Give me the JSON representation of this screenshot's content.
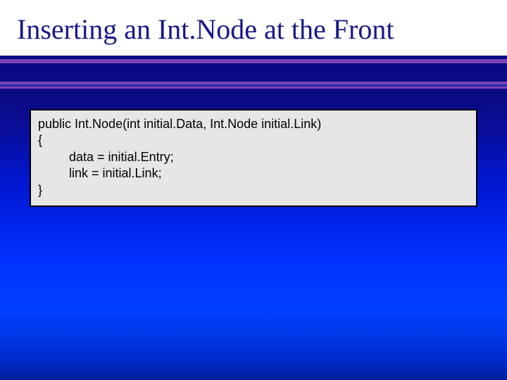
{
  "title": "Inserting an Int.Node at the Front",
  "code": {
    "line1": "public Int.Node(int initial.Data, Int.Node initial.Link)",
    "line2": "{",
    "line3": "    data = initial.Entry;",
    "line4": "    link = initial.Link;",
    "line5": "}"
  }
}
